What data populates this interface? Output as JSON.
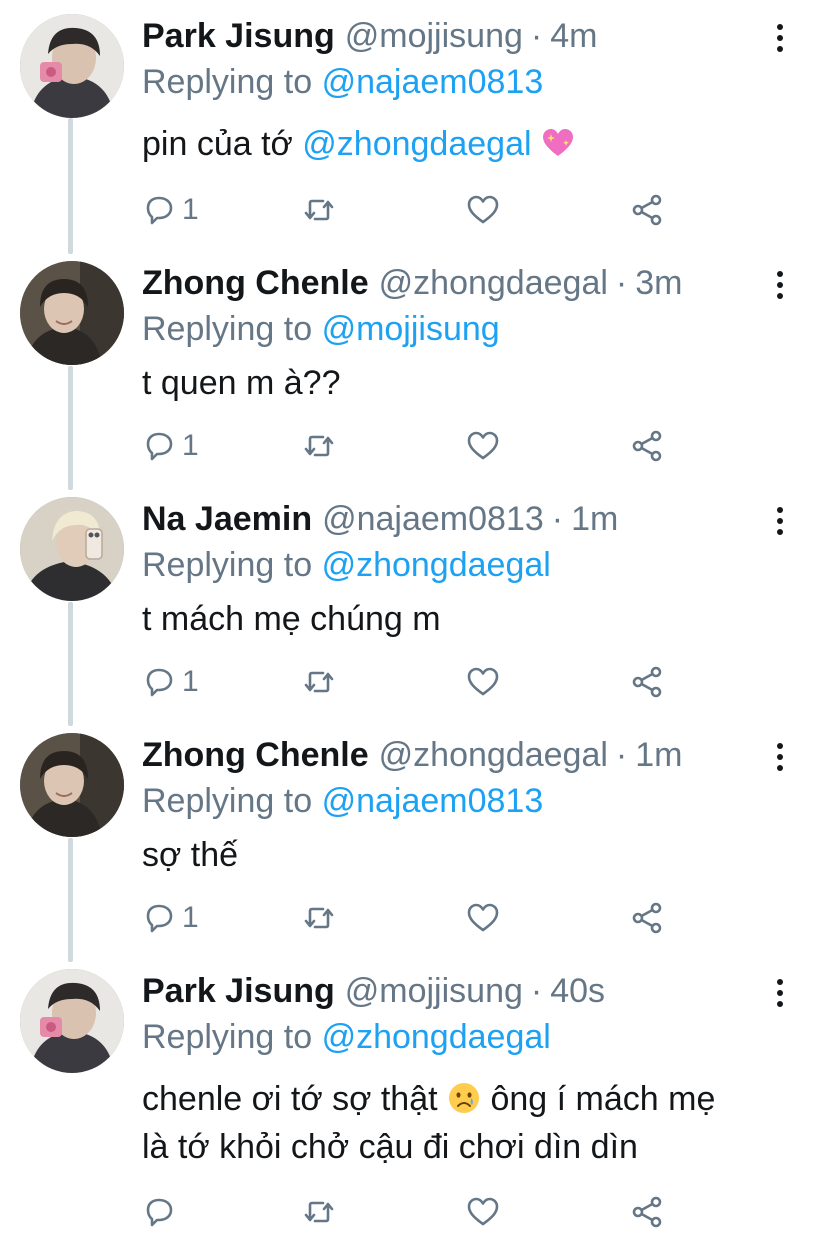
{
  "tweets": [
    {
      "name": "Park Jisung",
      "handle": "@mojjisung",
      "time": "4m",
      "replying_prefix": "Replying to",
      "replying_to": "@najaem0813",
      "body_parts": [
        "pin của tớ ",
        "@zhongdaegal",
        " "
      ],
      "emoji": "sparkling-heart-emoji",
      "reply_count": "1"
    },
    {
      "name": "Zhong Chenle",
      "handle": "@zhongdaegal",
      "time": "3m",
      "replying_prefix": "Replying to",
      "replying_to": "@mojjisung",
      "body": "t quen m à??",
      "reply_count": "1"
    },
    {
      "name": "Na Jaemin",
      "handle": "@najaem0813",
      "time": "1m",
      "replying_prefix": "Replying to",
      "replying_to": "@zhongdaegal",
      "body": "t mách mẹ chúng m",
      "reply_count": "1"
    },
    {
      "name": "Zhong Chenle",
      "handle": "@zhongdaegal",
      "time": "1m",
      "replying_prefix": "Replying to",
      "replying_to": "@najaem0813",
      "body": "sợ thế",
      "reply_count": "1"
    },
    {
      "name": "Park Jisung",
      "handle": "@mojjisung",
      "time": "40s",
      "replying_prefix": "Replying to",
      "replying_to": "@zhongdaegal",
      "body_line1_a": "chenle ơi tớ sợ thật ",
      "body_line1_b": " ông í mách mẹ",
      "body_line2": "là tớ khỏi chở cậu đi chơi dìn dìn",
      "emoji": "crying-face-emoji",
      "reply_count": ""
    }
  ],
  "colors": {
    "mention": "#1da1f2",
    "secondary_text": "#657786",
    "thread_line": "#cfd9de",
    "icon": "#657786"
  },
  "icons": [
    "reply-icon",
    "retweet-icon",
    "like-icon",
    "share-icon",
    "more-icon"
  ]
}
